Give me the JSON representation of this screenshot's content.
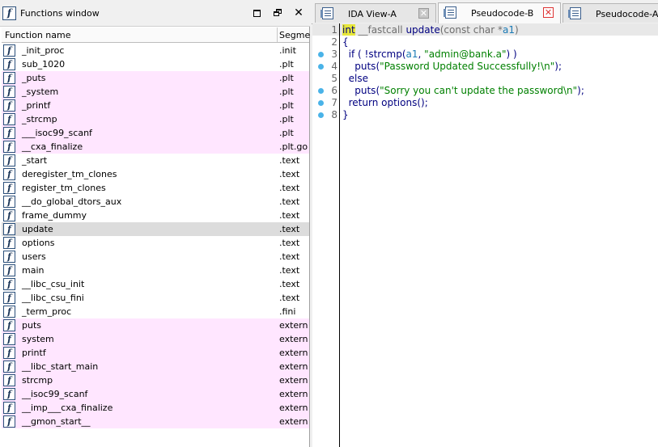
{
  "functions_window": {
    "title": "Functions window",
    "col_name": "Function name",
    "col_segment": "Segme",
    "rows": [
      {
        "name": "_init_proc",
        "segment": ".init",
        "style": ""
      },
      {
        "name": "sub_1020",
        "segment": ".plt",
        "style": ""
      },
      {
        "name": "_puts",
        "segment": ".plt",
        "style": "pink"
      },
      {
        "name": "_system",
        "segment": ".plt",
        "style": "pink"
      },
      {
        "name": "_printf",
        "segment": ".plt",
        "style": "pink"
      },
      {
        "name": "_strcmp",
        "segment": ".plt",
        "style": "pink"
      },
      {
        "name": "___isoc99_scanf",
        "segment": ".plt",
        "style": "pink"
      },
      {
        "name": "__cxa_finalize",
        "segment": ".plt.go",
        "style": "pink"
      },
      {
        "name": "_start",
        "segment": ".text",
        "style": ""
      },
      {
        "name": "deregister_tm_clones",
        "segment": ".text",
        "style": ""
      },
      {
        "name": "register_tm_clones",
        "segment": ".text",
        "style": ""
      },
      {
        "name": "__do_global_dtors_aux",
        "segment": ".text",
        "style": ""
      },
      {
        "name": "frame_dummy",
        "segment": ".text",
        "style": ""
      },
      {
        "name": "update",
        "segment": ".text",
        "style": "sel"
      },
      {
        "name": "options",
        "segment": ".text",
        "style": ""
      },
      {
        "name": "users",
        "segment": ".text",
        "style": ""
      },
      {
        "name": "main",
        "segment": ".text",
        "style": ""
      },
      {
        "name": "__libc_csu_init",
        "segment": ".text",
        "style": ""
      },
      {
        "name": "__libc_csu_fini",
        "segment": ".text",
        "style": ""
      },
      {
        "name": "_term_proc",
        "segment": ".fini",
        "style": ""
      },
      {
        "name": "puts",
        "segment": "extern",
        "style": "pink"
      },
      {
        "name": "system",
        "segment": "extern",
        "style": "pink"
      },
      {
        "name": "printf",
        "segment": "extern",
        "style": "pink"
      },
      {
        "name": "__libc_start_main",
        "segment": "extern",
        "style": "pink"
      },
      {
        "name": "strcmp",
        "segment": "extern",
        "style": "pink"
      },
      {
        "name": "__isoc99_scanf",
        "segment": "extern",
        "style": "pink"
      },
      {
        "name": "__imp___cxa_finalize",
        "segment": "extern",
        "style": "pink"
      },
      {
        "name": "__gmon_start__",
        "segment": "extern",
        "style": "pink"
      }
    ]
  },
  "tabs": [
    {
      "label": "IDA View-A",
      "active": false,
      "close_style": "gray"
    },
    {
      "label": "Pseudocode-B",
      "active": true,
      "close_style": "red"
    },
    {
      "label": "Pseudocode-A",
      "active": false,
      "close_style": "none"
    }
  ],
  "code_lines": [
    {
      "num": "1",
      "dot": false,
      "tokens": [
        {
          "t": "int",
          "c": "kw-hl"
        },
        {
          "t": " __fastcall ",
          "c": "gray"
        },
        {
          "t": "update",
          "c": "plain"
        },
        {
          "t": "(const char *",
          "c": "gray"
        },
        {
          "t": "a1",
          "c": "var"
        },
        {
          "t": ")",
          "c": "gray"
        }
      ]
    },
    {
      "num": "2",
      "dot": false,
      "tokens": [
        {
          "t": "{",
          "c": "plain"
        }
      ]
    },
    {
      "num": "3",
      "dot": true,
      "tokens": [
        {
          "t": "  if ( !",
          "c": "plain"
        },
        {
          "t": "strcmp",
          "c": "plain"
        },
        {
          "t": "(",
          "c": "plain"
        },
        {
          "t": "a1",
          "c": "var"
        },
        {
          "t": ", ",
          "c": "plain"
        },
        {
          "t": "\"admin@bank.a\"",
          "c": "str"
        },
        {
          "t": ") )",
          "c": "plain"
        }
      ]
    },
    {
      "num": "4",
      "dot": true,
      "tokens": [
        {
          "t": "    puts(",
          "c": "plain"
        },
        {
          "t": "\"Password Updated Successfully!\\n\"",
          "c": "str"
        },
        {
          "t": ");",
          "c": "plain"
        }
      ]
    },
    {
      "num": "5",
      "dot": false,
      "tokens": [
        {
          "t": "  else",
          "c": "plain"
        }
      ]
    },
    {
      "num": "6",
      "dot": true,
      "tokens": [
        {
          "t": "    puts(",
          "c": "plain"
        },
        {
          "t": "\"Sorry you can't update the password\\n\"",
          "c": "str"
        },
        {
          "t": ");",
          "c": "plain"
        }
      ]
    },
    {
      "num": "7",
      "dot": true,
      "tokens": [
        {
          "t": "  return options();",
          "c": "plain"
        }
      ]
    },
    {
      "num": "8",
      "dot": true,
      "tokens": [
        {
          "t": "}",
          "c": "plain"
        }
      ]
    }
  ]
}
